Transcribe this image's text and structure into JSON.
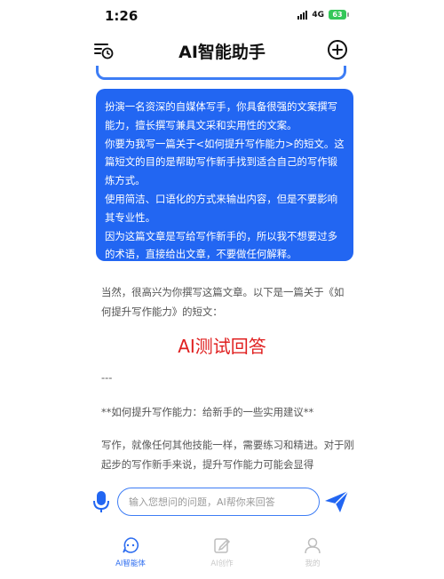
{
  "status_bar": {
    "time": "1:26",
    "network": "4G",
    "battery": "63"
  },
  "header": {
    "title": "AI智能助手",
    "history_icon": "history-list-icon",
    "add_icon": "plus-circle-icon"
  },
  "prompt": {
    "text": "扮演一名资深的自媒体写手，你具备很强的文案撰写能力，擅长撰写兼具文采和实用性的文案。\n你要为我写一篇关于<如何提升写作能力>的短文。这篇短文的目的是帮助写作新手找到适合自己的写作锻炼方式。\n使用简洁、口语化的方式来输出内容，但是不要影响其专业性。\n因为这篇文章是写给写作新手的，所以我不想要过多的术语，直接给出文章，不要做任何解释。"
  },
  "answer": {
    "intro": "当然，很高兴为你撰写这篇文章。以下是一篇关于《如何提升写作能力》的短文：",
    "watermark": "AI测试回答",
    "separator": "---",
    "subtitle": "**如何提升写作能力：给新手的一些实用建议**",
    "body": "写作，就像任何其他技能一样，需要练习和精进。对于刚起步的写作新手来说，提升写作能力可能会显得"
  },
  "composer": {
    "placeholder": "输入您想问的问题，AI帮你来回答",
    "mic_icon": "microphone-icon",
    "send_icon": "send-icon"
  },
  "tabs": [
    {
      "label": "AI智能体",
      "icon": "chat-bubble-icon",
      "active": true
    },
    {
      "label": "AI创作",
      "icon": "edit-icon",
      "active": false
    },
    {
      "label": "我的",
      "icon": "user-icon",
      "active": false
    }
  ],
  "colors": {
    "accent": "#2266f2",
    "watermark": "#e02020",
    "inactive_tab": "#c9c9c9"
  }
}
